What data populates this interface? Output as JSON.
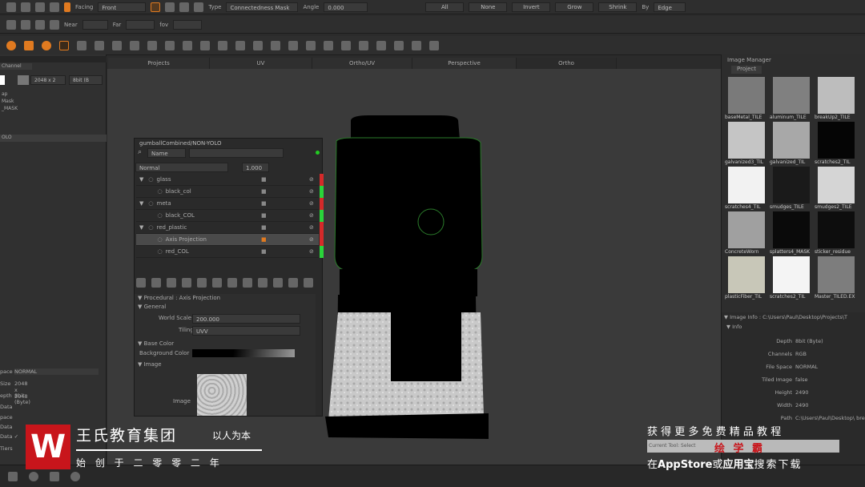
{
  "toolbar1": {
    "facing_label": "Facing",
    "facing_value": "Front",
    "type_label": "Type",
    "type_value": "Connectedness Mask",
    "angle_label": "Angle",
    "angle_value": "0.000",
    "buttons": [
      "All",
      "None",
      "Invert",
      "Grow",
      "Shrink"
    ],
    "by_label": "By",
    "by_value": "Edge"
  },
  "toolbar2": {
    "near_label": "Near",
    "far_label": "Far",
    "fov_label": "fov"
  },
  "viewport_tabs": [
    "Projects",
    "UV",
    "Ortho/UV",
    "Perspective",
    "Ortho"
  ],
  "left_panel": {
    "tab": "Channel",
    "size": "2048 x 2",
    "depth": "8bit (B",
    "items": [
      "ap",
      "Mask",
      "_MASK",
      "",
      "",
      "",
      "OLO",
      ""
    ],
    "props": [
      {
        "k": "pace",
        "v": "NORMAL"
      },
      {
        "k": "Size",
        "v": "2048 x 2048"
      },
      {
        "k": "epth",
        "v": "8bit (Byte)"
      },
      {
        "k": "Data",
        "v": ""
      },
      {
        "k": "pace",
        "v": ""
      },
      {
        "k": "Data",
        "v": ""
      },
      {
        "k": "Data",
        "v": "✓"
      },
      {
        "k": "Tiers",
        "v": ""
      }
    ]
  },
  "layers": {
    "title": "gumballCombined/NON-YOLO",
    "search_mode": "Name",
    "blend": "Normal",
    "opacity": "1.000",
    "rows": [
      {
        "name": "glass",
        "group": true,
        "tag": "#d42a2a"
      },
      {
        "name": "black_col",
        "group": false,
        "tag": "#2ad43a"
      },
      {
        "name": "meta",
        "group": true,
        "tag": "#d42a2a"
      },
      {
        "name": "black_COL",
        "group": false,
        "tag": "#2ad43a"
      },
      {
        "name": "red_plastic",
        "group": true,
        "tag": "#d42a2a"
      },
      {
        "name": "Axis Projection",
        "group": false,
        "tag": "#d42a2a",
        "selected": true
      },
      {
        "name": "red_COL",
        "group": false,
        "tag": "#2ad43a"
      }
    ]
  },
  "properties": {
    "header": "Procedural : Axis Projection",
    "general": "General",
    "world_scale_label": "World Scale",
    "world_scale": "200.000",
    "tiling_label": "Tiling",
    "tiling": "UVV",
    "base_color": "Base Color",
    "bg_color_label": "Background Color",
    "image_section": "Image",
    "image_label": "Image"
  },
  "image_manager": {
    "title": "Image Manager",
    "tab": "Project",
    "thumbs": [
      {
        "name": "baseMetal_TILE",
        "c": "#7a7a7a"
      },
      {
        "name": "aluminum_TILE",
        "c": "#808080"
      },
      {
        "name": "breakUp2_TILE",
        "c": "#bdbdbd"
      },
      {
        "name": "galvanized3_TIL",
        "c": "#c5c5c5"
      },
      {
        "name": "galvanized_TIL",
        "c": "#a8a8a8"
      },
      {
        "name": "scratches2_TIL",
        "c": "#050505"
      },
      {
        "name": "scratches4_TIL",
        "c": "#f2f2f2"
      },
      {
        "name": "smudges_TILE",
        "c": "#1a1a1a"
      },
      {
        "name": "smudges2_TILE",
        "c": "#d5d5d5"
      },
      {
        "name": "ConcreteWorn",
        "c": "#a0a0a0"
      },
      {
        "name": "splatters4_MASK",
        "c": "#0a0a0a"
      },
      {
        "name": "sticker_residue",
        "c": "#0d0d0d"
      },
      {
        "name": "plasticFiber_TIL",
        "c": "#c8c7b8"
      },
      {
        "name": "scratches2_TIL",
        "c": "#f4f4f4"
      },
      {
        "name": "Master_TILED.EX",
        "c": "#7d7d7d"
      }
    ]
  },
  "image_info": {
    "header": "Image Info : C:\\Users\\Paul\\Desktop\\Projects\\T",
    "section": "Info",
    "rows": [
      {
        "k": "Depth",
        "v": "8bit (Byte)"
      },
      {
        "k": "Channels",
        "v": "RGB"
      },
      {
        "k": "File Space",
        "v": "NORMAL"
      },
      {
        "k": "Tiled Image",
        "v": "false"
      },
      {
        "k": "Height",
        "v": "2490"
      },
      {
        "k": "Width",
        "v": "2490"
      },
      {
        "k": "Path",
        "v": "C:\\Users\\Paul\\Desktop\\ breakUp2_TILED.tif"
      }
    ],
    "current_tool": "Current Tool: Select"
  },
  "watermark": {
    "brand": "王氏教育集团",
    "slogan": "以人为本",
    "founded": "始 创 于 二 零 零 二 年",
    "promo1": "获 得 更 多 免 费 精 品 教 程",
    "promo_app": "绘 学 霸",
    "promo2_a": "在",
    "promo2_b": "AppStore",
    "promo2_c": "或",
    "promo2_d": "应用宝",
    "promo2_e": "搜索下载"
  },
  "colors": {
    "accent": "#e07a20",
    "logo_red": "#c8151b"
  }
}
